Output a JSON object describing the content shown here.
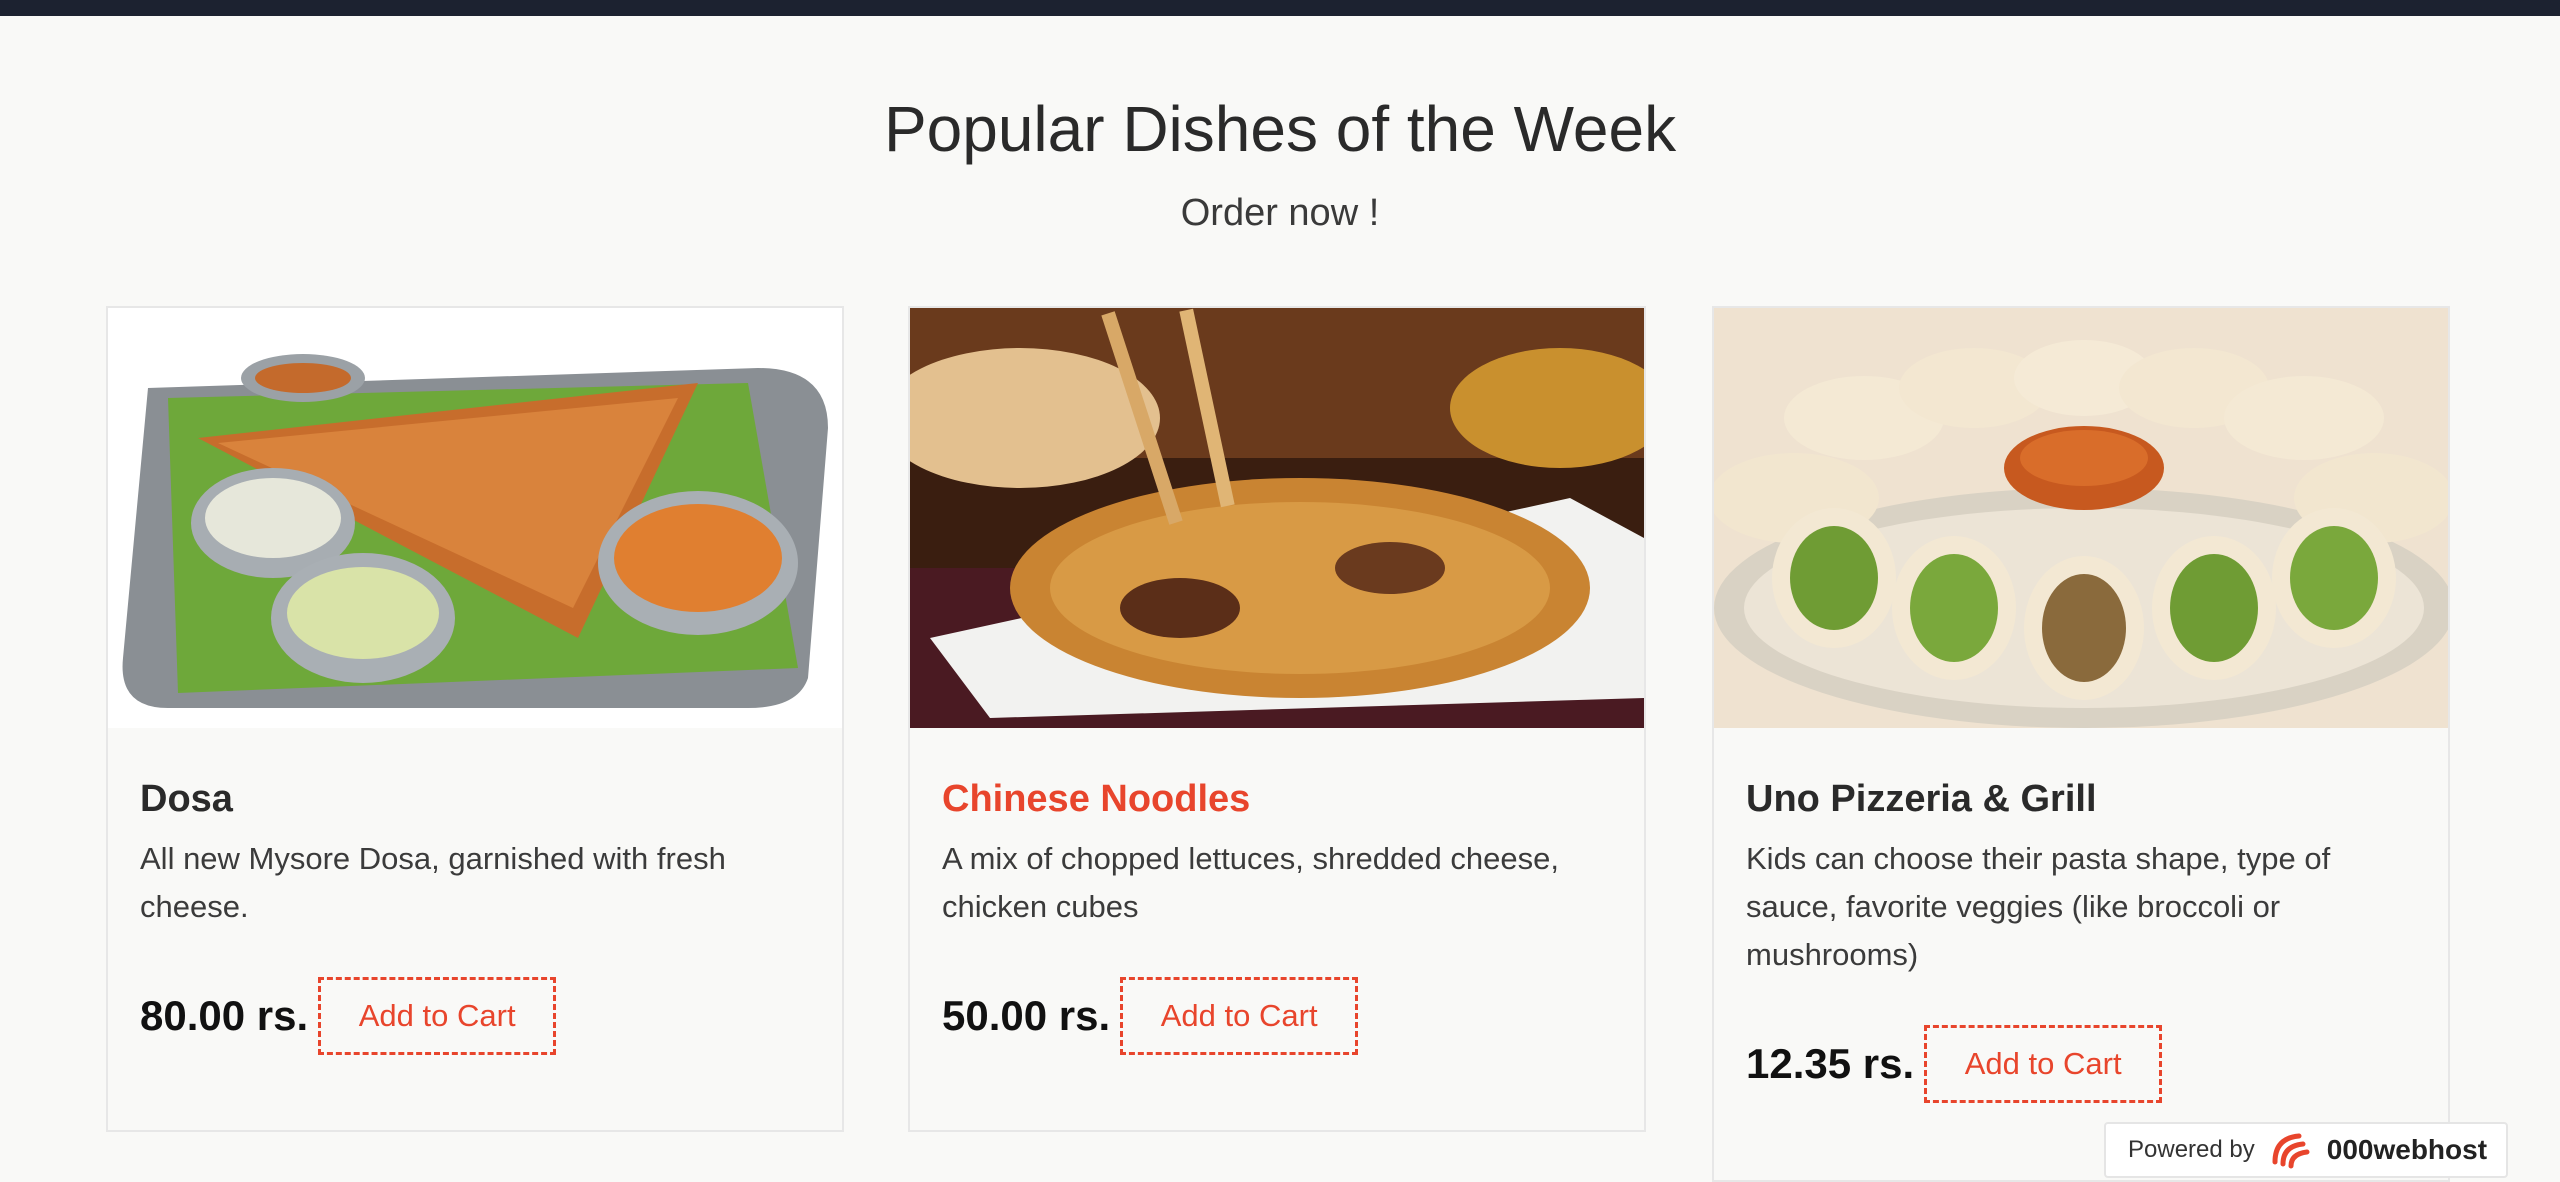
{
  "section": {
    "title": "Popular Dishes of the Week",
    "subtitle": "Order now !"
  },
  "cards": [
    {
      "title": "Dosa",
      "description": "All new Mysore Dosa, garnished with fresh cheese.",
      "price": "80.00 rs.",
      "button": "Add to Cart"
    },
    {
      "title": "Chinese Noodles",
      "description": "A mix of chopped lettuces, shredded cheese, chicken cubes",
      "price": "50.00 rs.",
      "button": "Add to Cart"
    },
    {
      "title": "Uno Pizzeria & Grill",
      "description": "Kids can choose their pasta shape, type of sauce, favorite veggies (like broccoli or mushrooms)",
      "price": "12.35 rs.",
      "button": "Add to Cart"
    }
  ],
  "badge": {
    "powered_label": "Powered by",
    "brand": "000webhost"
  },
  "colors": {
    "accent": "#e8452c",
    "top_bar": "#1c2230",
    "background": "#f9f9f7"
  }
}
